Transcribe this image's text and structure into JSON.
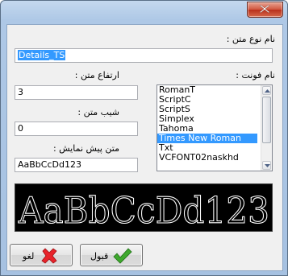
{
  "title_bar": {
    "close_icon": "close-icon"
  },
  "labels": {
    "text_style_name": "نام نوع متن :",
    "text_height": "ارتفاع متن :",
    "font_name": "نام فونت :",
    "text_slope": "شیب متن :",
    "preview_text_label": "متن پیش نمایش :"
  },
  "fields": {
    "style_name_value": "Details_TS",
    "height_value": "3",
    "slope_value": "0",
    "preview_value": "AaBbCcDd123"
  },
  "font_list": {
    "items": [
      "RomanT",
      "ScriptC",
      "ScriptS",
      "Simplex",
      "Tahoma",
      "Times New Roman",
      "Txt",
      "VCFONT02naskhd"
    ],
    "selected": "Times New Roman"
  },
  "preview": {
    "text": "AaBbCcDd123",
    "color": "#ffffff",
    "background": "#000000"
  },
  "buttons": {
    "cancel_label": "لغو",
    "ok_label": "قبول",
    "cancel_icon": "red-x-icon",
    "ok_icon": "green-check-icon",
    "cancel_icon_color": "#e8232b",
    "ok_icon_color": "#3ea82d"
  }
}
